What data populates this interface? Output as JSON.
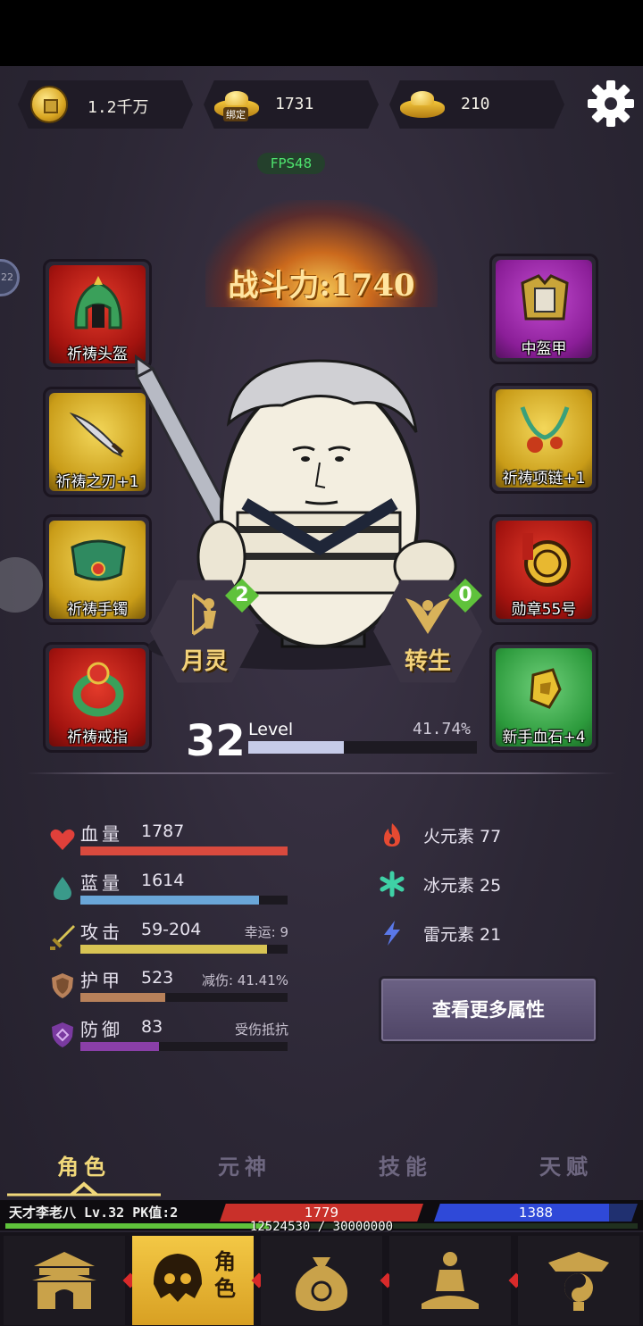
{
  "currency": {
    "coins": "1.2千万",
    "bound_gold": "1731",
    "bound_tag": "绑定",
    "gold": "210"
  },
  "fps": "FPS48",
  "power": "战斗力:1740",
  "equipment_left": [
    {
      "label": "祈祷头盔",
      "rarity": "red"
    },
    {
      "label": "祈祷之刃+1",
      "rarity": "yellow"
    },
    {
      "label": "祈祷手镯",
      "rarity": "yellow"
    },
    {
      "label": "祈祷戒指",
      "rarity": "red"
    }
  ],
  "equipment_right": [
    {
      "label": "中盔甲",
      "rarity": "purple"
    },
    {
      "label": "祈祷项链+1",
      "rarity": "yellow"
    },
    {
      "label": "勋章55号",
      "rarity": "red"
    },
    {
      "label": "新手血石+4",
      "rarity": "green"
    }
  ],
  "side_stub_text": "22",
  "badges": {
    "moon": {
      "label": "月灵",
      "count": "2"
    },
    "rebirth": {
      "label": "转生",
      "count": "0"
    }
  },
  "level": {
    "number": "32",
    "label": "Level",
    "percent": "41.74%",
    "progress": 0.4174
  },
  "stats": [
    {
      "name": "血量",
      "value": "1787",
      "extra": "",
      "fill": 1.0,
      "color": "#d94a3e",
      "icon": "heart-icon"
    },
    {
      "name": "蓝量",
      "value": "1614",
      "extra": "",
      "fill": 0.86,
      "color": "#6aa6d8",
      "icon": "drop-icon"
    },
    {
      "name": "攻击",
      "value": "59-204",
      "extra": "幸运: 9",
      "fill": 0.9,
      "color": "#d8c454",
      "icon": "sword-icon"
    },
    {
      "name": "护甲",
      "value": "523",
      "extra": "减伤: 41.41%",
      "fill": 0.41,
      "color": "#b8815a",
      "icon": "shield-icon"
    },
    {
      "name": "防御",
      "value": "83",
      "extra": "受伤抵抗",
      "fill": 0.38,
      "color": "#8a3fa8",
      "icon": "defense-icon"
    }
  ],
  "elements": [
    {
      "text": "火元素 77",
      "color": "#e64a32",
      "icon": "fire-icon"
    },
    {
      "text": "冰元素 25",
      "color": "#3fd1a6",
      "icon": "snowflake-icon"
    },
    {
      "text": "雷元素 21",
      "color": "#5a78e8",
      "icon": "lightning-icon"
    }
  ],
  "more_button": "查看更多属性",
  "tabs": [
    "角色",
    "元神",
    "技能",
    "天赋"
  ],
  "active_tab": 0,
  "player": {
    "info": "天才李老八 Lv.32 PK值:2",
    "hp": "1779",
    "mp": "1388",
    "mp_fill": 0.86,
    "exp": "12524530 / 30000000",
    "exp_fill": 0.417
  },
  "nav": {
    "active_label": "角色"
  },
  "colors": {
    "accent_gold": "#f1d87a",
    "bg": "#2c2735"
  }
}
